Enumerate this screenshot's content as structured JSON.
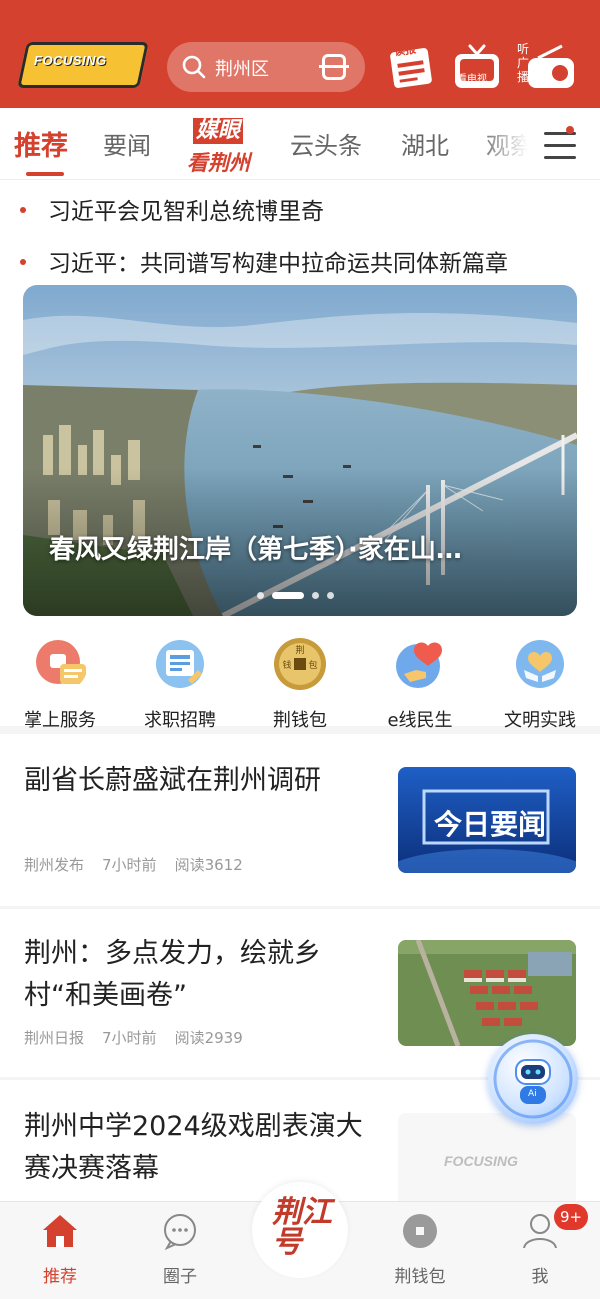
{
  "header": {
    "logo_text": "FOCUSING",
    "search_placeholder": "荆州区",
    "icons": [
      {
        "name": "read-newspaper-icon",
        "label": "读报"
      },
      {
        "name": "watch-tv-icon",
        "label": "看电视"
      },
      {
        "name": "listen-radio-icon",
        "label": "听广播"
      }
    ]
  },
  "tabs": {
    "items": [
      "推荐",
      "要闻",
      "云头条",
      "湖北",
      "观察"
    ],
    "special_line1": "媒眼",
    "special_line2": "看荆州",
    "active": "推荐"
  },
  "headlines": [
    "习近平会见智利总统博里奇",
    "习近平：共同谱写构建中拉命运共同体新篇章"
  ],
  "banner": {
    "title": "春风又绿荆江岸（第七季）·家在山…",
    "pages": 4,
    "active_page": 2
  },
  "services": [
    {
      "label": "掌上服务",
      "icon": "chat-service-icon",
      "color": "#f08a7c"
    },
    {
      "label": "求职招聘",
      "icon": "job-board-icon",
      "color": "#7fb6ee"
    },
    {
      "label": "荆钱包",
      "icon": "coin-wallet-icon",
      "color": "#c79a3a"
    },
    {
      "label": "e线民生",
      "icon": "heart-hand-icon",
      "color": "#6fa9ec"
    },
    {
      "label": "文明实践",
      "icon": "hands-heart-icon",
      "color": "#7fb8ee"
    }
  ],
  "news": [
    {
      "title": "副省长蔚盛斌在荆州调研",
      "source": "荆州发布",
      "time": "7小时前",
      "reads": "阅读3612",
      "thumb_text": "今日要闻"
    },
    {
      "title": "荆州：多点发力，绘就乡村“和美画卷”",
      "source": "荆州日报",
      "time": "7小时前",
      "reads": "阅读2939",
      "thumb_text": ""
    },
    {
      "title": "荆州中学2024级戏剧表演大赛决赛落幕",
      "source": "",
      "time": "",
      "reads": "",
      "thumb_text": "FOCUSING"
    }
  ],
  "ai_assistant": {
    "label": "Ai"
  },
  "bottom_nav": {
    "items": [
      {
        "label": "推荐",
        "icon": "home-icon"
      },
      {
        "label": "圈子",
        "icon": "chat-bubble-icon"
      },
      {
        "label": "荆钱包",
        "icon": "coin-icon"
      },
      {
        "label": "我",
        "icon": "user-icon"
      }
    ],
    "center_text": "荆江号",
    "badge": "9+"
  },
  "colors": {
    "brand": "#d4422f",
    "active": "#d4422f",
    "muted": "#999999"
  }
}
